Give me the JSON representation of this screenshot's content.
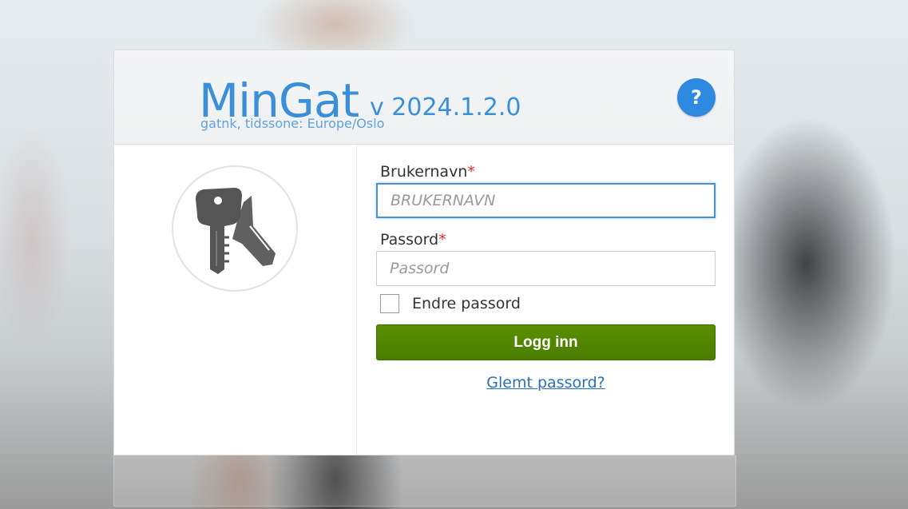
{
  "app": {
    "title": "MinGat",
    "version": "v 2024.1.2.0",
    "tenant_line": "gatnk, tidssone: Europe/Oslo",
    "help_label": "?"
  },
  "login_form": {
    "username_label": "Brukernavn",
    "username_placeholder": "BRUKERNAVN",
    "username_value": "",
    "password_label": "Passord",
    "password_placeholder": "Passord",
    "password_value": "",
    "required_marker": "*",
    "change_password_label": "Endre passord",
    "change_password_checked": false,
    "submit_label": "Logg inn",
    "forgot_password_label": "Glemt passord?"
  },
  "icons": {
    "key_illustration": "keys-icon",
    "help": "question-mark-icon"
  },
  "colors": {
    "brand_blue": "#3a8fd8",
    "help_button": "#2d8ae0",
    "login_button": "#4f8400",
    "link": "#2a70b8",
    "required": "#c9302c",
    "focus_border": "#4a90d9"
  }
}
